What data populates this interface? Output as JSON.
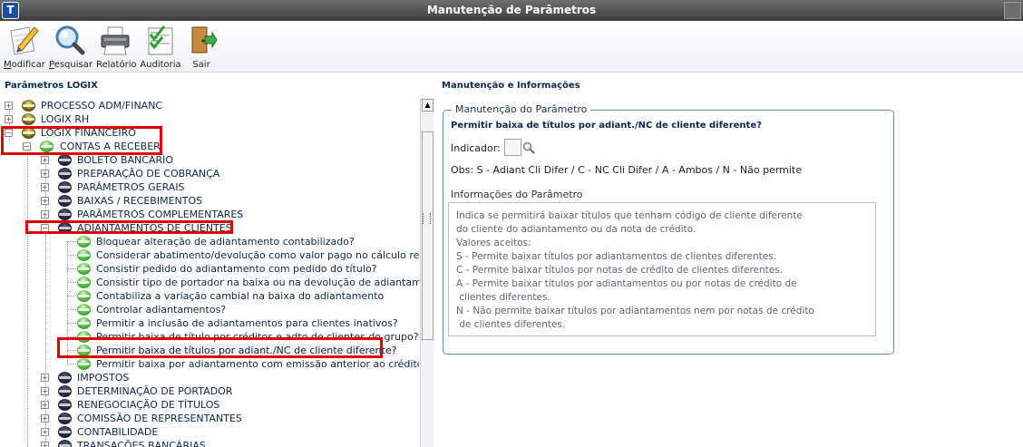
{
  "window": {
    "title": "Manutenção de Parâmetros",
    "app_icon": "T"
  },
  "toolbar": {
    "items": [
      {
        "key": "M",
        "rest": "odificar",
        "icon": "pencil-paper-icon"
      },
      {
        "key": "P",
        "rest": "esquisar",
        "icon": "magnifier-icon"
      },
      {
        "key": "",
        "rest": "Relatório",
        "icon": "printer-icon"
      },
      {
        "key": "",
        "rest": "Auditoria",
        "icon": "checklist-icon"
      },
      {
        "key": "",
        "rest": "Sair",
        "icon": "exit-door-icon"
      }
    ]
  },
  "left_panel": {
    "title": "Parâmetros LOGIX",
    "tree": [
      {
        "label": "PROCESSO ADM/FINANC",
        "level": 0,
        "expander": "+",
        "node": "gold"
      },
      {
        "label": "LOGIX RH",
        "level": 0,
        "expander": "+",
        "node": "gold"
      },
      {
        "label": "LOGIX FINANCEIRO",
        "level": 0,
        "expander": "-",
        "node": "gold"
      },
      {
        "label": "CONTAS A RECEBER",
        "level": 1,
        "expander": "-",
        "node": "leaf"
      },
      {
        "label": "BOLETO BANCÁRIO",
        "level": 2,
        "expander": "+",
        "node": "dark"
      },
      {
        "label": "PREPARAÇÃO DE COBRANÇA",
        "level": 2,
        "expander": "+",
        "node": "dark"
      },
      {
        "label": "PARÂMETROS GERAIS",
        "level": 2,
        "expander": "+",
        "node": "dark"
      },
      {
        "label": "BAIXAS / RECEBIMENTOS",
        "level": 2,
        "expander": "+",
        "node": "dark"
      },
      {
        "label": "PARÂMETROS COMPLEMENTARES",
        "level": 2,
        "expander": "+",
        "node": "dark"
      },
      {
        "label": "ADIANTAMENTOS DE CLIENTES",
        "level": 2,
        "expander": "-",
        "node": "dark"
      },
      {
        "label": "Bloquear alteração de adiantamento contabilizado?",
        "level": 3,
        "expander": "",
        "node": "leaf"
      },
      {
        "label": "Considerar abatimento/devolução como valor pago no cálculo retenção?",
        "level": 3,
        "expander": "",
        "node": "leaf"
      },
      {
        "label": "Consistir pedido do adiantamento com pedido do título?",
        "level": 3,
        "expander": "",
        "node": "leaf"
      },
      {
        "label": "Consistir tipo de portador na baixa ou na devolução de adiantamento?",
        "level": 3,
        "expander": "",
        "node": "leaf"
      },
      {
        "label": "Contabiliza a variação cambial na baixa do adiantamento",
        "level": 3,
        "expander": "",
        "node": "leaf"
      },
      {
        "label": "Controlar adiantamentos?",
        "level": 3,
        "expander": "",
        "node": "leaf"
      },
      {
        "label": "Permitir a inclusão de adiantamentos para clientes inativos?",
        "level": 3,
        "expander": "",
        "node": "leaf"
      },
      {
        "label": "Permitir baixa de título por créditos e adto de clientes do grupo?",
        "level": 3,
        "expander": "",
        "node": "leaf"
      },
      {
        "label": "Permitir baixa de títulos por adiant./NC de cliente diferente?",
        "level": 3,
        "expander": "",
        "node": "leaf",
        "selected": true
      },
      {
        "label": "Permitir baixa por adiantamento com emissão anterior ao crédito?",
        "level": 3,
        "expander": "",
        "node": "leaf"
      },
      {
        "label": "IMPOSTOS",
        "level": 2,
        "expander": "+",
        "node": "dark"
      },
      {
        "label": "DETERMINAÇÃO DE PORTADOR",
        "level": 2,
        "expander": "+",
        "node": "dark"
      },
      {
        "label": "RENEGOCIAÇÃO DE TÍTULOS",
        "level": 2,
        "expander": "+",
        "node": "dark"
      },
      {
        "label": "COMISSÃO DE REPRESENTANTES",
        "level": 2,
        "expander": "+",
        "node": "dark"
      },
      {
        "label": "CONTABILIDADE",
        "level": 2,
        "expander": "+",
        "node": "dark"
      },
      {
        "label": "TRANSAÇÕES BANCÁRIAS",
        "level": 2,
        "expander": "+",
        "node": "dark"
      }
    ]
  },
  "right_panel": {
    "title": "Manutenção e Informações",
    "group_title": "Manutenção do Parâmetro",
    "question": "Permitir baixa de títulos por adiant./NC de cliente diferente?",
    "indicator_label": "Indicador:",
    "indicator_value": "",
    "obs": "Obs: S - Adiant Cli Difer / C - NC Cli Difer / A - Ambos / N - Não permite",
    "info_label": "Informações do Parâmetro",
    "info_text": "Indica se permitirá baixar títulos que tenham código de cliente diferente\ndo cliente do adiantamento ou da nota de crédito.\nValores aceitos:\nS - Permite baixar títulos por adiantamentos de clientes diferentes.\nC - Permite baixar títulos por notas de crédito de clientes diferentes.\nA - Permite baixar títulos por adiantamentos ou por notas de crédito de\n clientes diferentes.\nN - Não permite baixar títulos por adiantamentos nem por notas de crédito\n de clientes diferentes."
  },
  "colors": {
    "titlebar": "#4f4f4f",
    "highlight_box": "#e00000",
    "tree_text": "#0b2a4a",
    "group_border": "#5a8fa8"
  }
}
